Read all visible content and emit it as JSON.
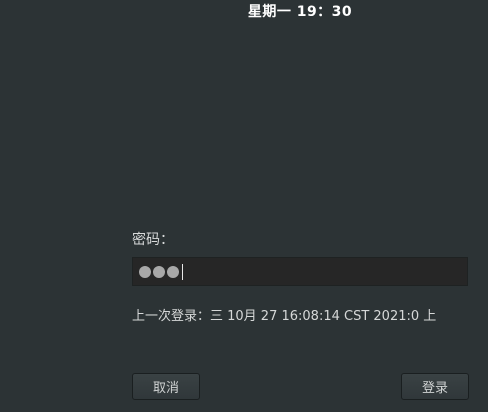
{
  "topbar": {
    "clock": "星期一 19：30"
  },
  "login": {
    "password_label": "密码：",
    "password_value": "●●●",
    "last_login": "上一次登录：三 10月  27 16:08:14 CST 2021:0 上",
    "cancel_label": "取消",
    "login_label": "登录"
  },
  "colors": {
    "background": "#2c3335",
    "field_background": "#262626",
    "text": "#d8dada",
    "clock": "#ffffff"
  }
}
